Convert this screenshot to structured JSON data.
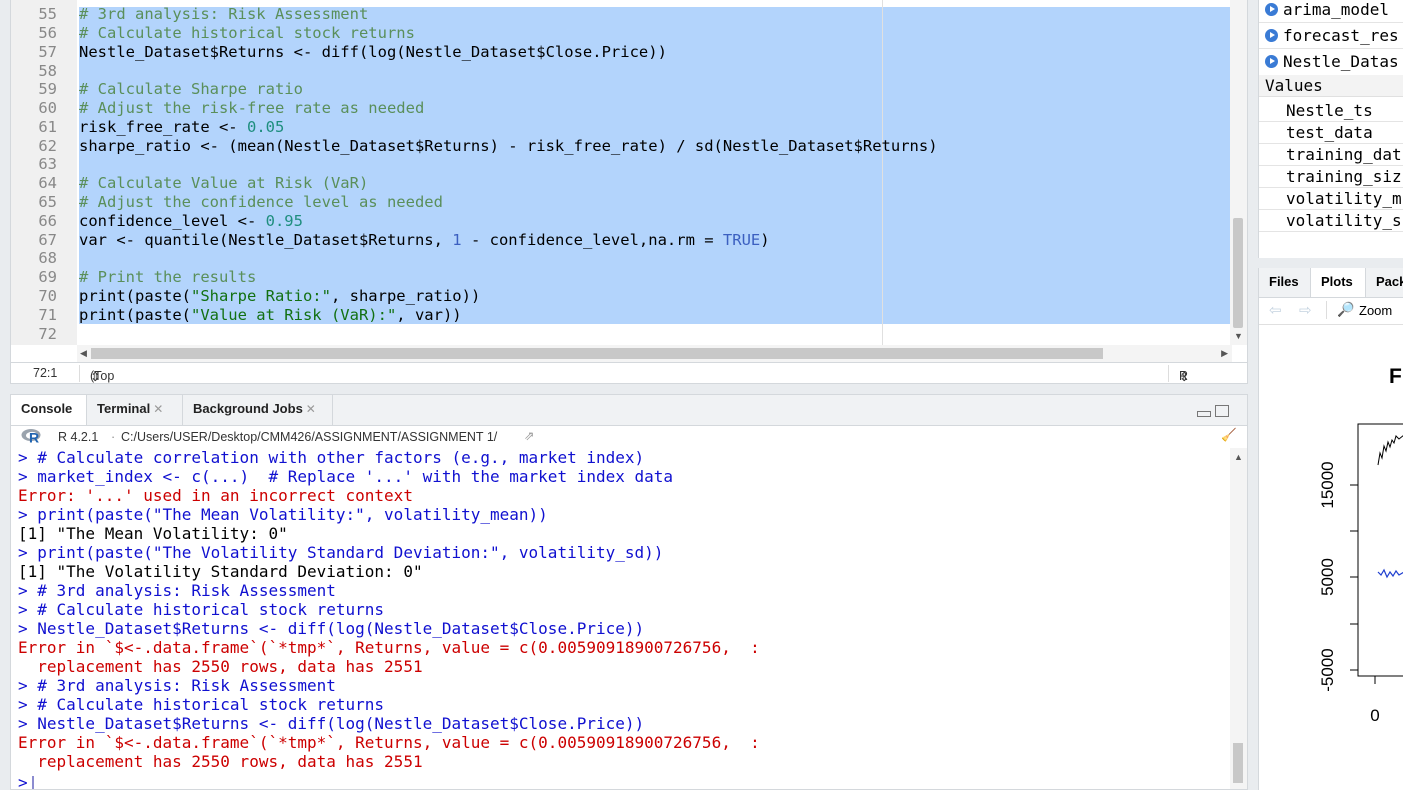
{
  "editor": {
    "line_numbers": [
      "55",
      "56",
      "57",
      "58",
      "59",
      "60",
      "61",
      "62",
      "63",
      "64",
      "65",
      "66",
      "67",
      "68",
      "69",
      "70",
      "71",
      "72"
    ],
    "cursor_position": "72:1",
    "scope": "(Top Level)",
    "file_type": "R Script"
  },
  "console": {
    "tabs": [
      "Console",
      "Terminal",
      "Background Jobs"
    ],
    "r_version": "R 4.2.1",
    "working_dir": "C:/Users/USER/Desktop/CMM426/ASSIGNMENT/ASSIGNMENT 1/",
    "prompt": ">"
  },
  "environment": {
    "data_items": [
      "arima_model",
      "forecast_res",
      "Nestle_Datas"
    ],
    "values_header": "Values",
    "values": [
      "Nestle_ts",
      "test_data",
      "training_dat",
      "training_siz",
      "volatility_m",
      "volatility_s"
    ]
  },
  "files_pane": {
    "tabs": [
      "Files",
      "Plots",
      "Pack"
    ],
    "zoom_label": "Zoom",
    "plot_title_fragment": "F",
    "y_ticks": [
      "15000",
      "5000",
      "-5000"
    ],
    "x_tick": "0"
  },
  "colors": {
    "selection": "#b3d4fc",
    "comment": "#5a8f5a",
    "console_input": "#1010d0",
    "console_error": "#cc0000"
  }
}
